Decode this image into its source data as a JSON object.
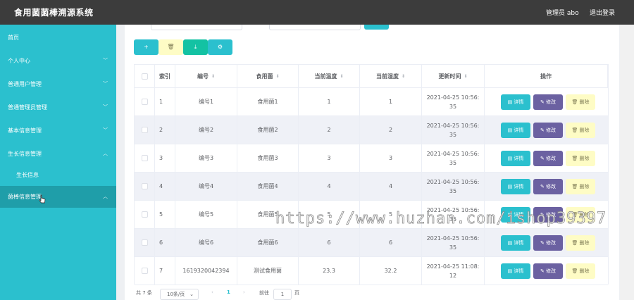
{
  "header": {
    "title": "食用菌菌棒溯源系统",
    "admin_label": "管理员 abo",
    "logout_label": "退出登录"
  },
  "sidebar": {
    "items": [
      {
        "label": "首页",
        "has_arrow": false
      },
      {
        "label": "个人中心",
        "has_arrow": true
      },
      {
        "label": "普通用户管理",
        "has_arrow": true
      },
      {
        "label": "普通管理员管理",
        "has_arrow": true
      },
      {
        "label": "基本信息管理",
        "has_arrow": true
      },
      {
        "label": "生长信息管理",
        "has_arrow": true
      },
      {
        "label": "生长信息",
        "has_arrow": false
      },
      {
        "label": "菌棒信息管理",
        "has_arrow": true
      }
    ]
  },
  "toolbar": {
    "add_icon": "+",
    "delete_icon": "🗑",
    "download_icon": "⤓",
    "settings_icon": "⚙"
  },
  "table": {
    "headers": {
      "index": "索引",
      "code": "编号",
      "fungus": "食用菌",
      "cur_temp": "当前温度",
      "cur_humidity": "当前湿度",
      "updated": "更新时间",
      "actions": "操作"
    },
    "rows": [
      {
        "index": "1",
        "code": "编号1",
        "fungus": "食用菌1",
        "cur_temp": "1",
        "cur_humidity": "1",
        "updated_line1": "2021-04-25 10:56:",
        "updated_line2": "35"
      },
      {
        "index": "2",
        "code": "编号2",
        "fungus": "食用菌2",
        "cur_temp": "2",
        "cur_humidity": "2",
        "updated_line1": "2021-04-25 10:56:",
        "updated_line2": "35"
      },
      {
        "index": "3",
        "code": "编号3",
        "fungus": "食用菌3",
        "cur_temp": "3",
        "cur_humidity": "3",
        "updated_line1": "2021-04-25 10:56:",
        "updated_line2": "35"
      },
      {
        "index": "4",
        "code": "编号4",
        "fungus": "食用菌4",
        "cur_temp": "4",
        "cur_humidity": "4",
        "updated_line1": "2021-04-25 10:56:",
        "updated_line2": "35"
      },
      {
        "index": "5",
        "code": "编号5",
        "fungus": "食用菌5",
        "cur_temp": "5",
        "cur_humidity": "5",
        "updated_line1": "2021-04-25 10:56:",
        "updated_line2": "35"
      },
      {
        "index": "6",
        "code": "编号6",
        "fungus": "食用菌6",
        "cur_temp": "6",
        "cur_humidity": "6",
        "updated_line1": "2021-04-25 10:56:",
        "updated_line2": "35"
      },
      {
        "index": "7",
        "code": "1619320042394",
        "fungus": "测试食用菌",
        "cur_temp": "23.3",
        "cur_humidity": "32.2",
        "updated_line1": "2021-04-25 11:08:",
        "updated_line2": "12"
      }
    ],
    "action_labels": {
      "detail": "▤ 详情",
      "edit": "✎ 修改",
      "delete": "🗑 删除"
    }
  },
  "pagination": {
    "total": "共 7 条",
    "page_size": "10条/页",
    "prev": "‹",
    "current_page": "1",
    "next": "›",
    "goto_label": "前往",
    "goto_value": "1",
    "page_suffix": "页"
  },
  "watermark": "https://www.huzhan.com/ishop39397",
  "colors": {
    "topbar": "#3c3c3c",
    "sidebar": "#2bc0ce",
    "sidebar_active": "#1f9ea9",
    "edit_button": "#6b61a1",
    "delete_button": "#fefcc5",
    "download_button": "#13c2a3",
    "row_stripe": "#eff1f7"
  }
}
